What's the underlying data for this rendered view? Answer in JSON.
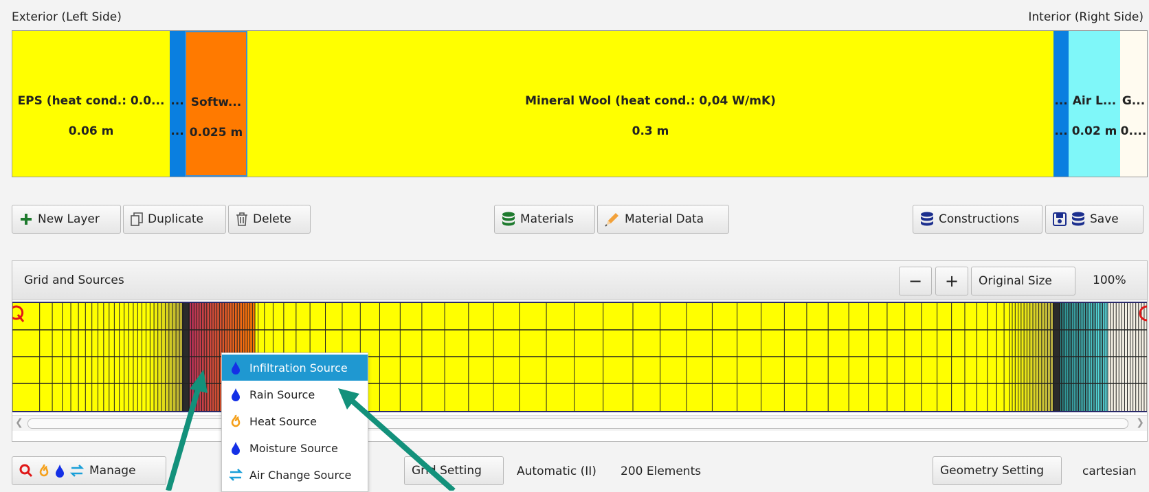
{
  "labels": {
    "exterior": "Exterior (Left Side)",
    "interior": "Interior (Right Side)"
  },
  "layers": [
    {
      "name": "EPS (heat cond.: 0.0...",
      "thickness": "0.06 m",
      "color": "#ffff00"
    },
    {
      "name": "...",
      "thickness": "...",
      "color": "#0a7fe0"
    },
    {
      "name": "Softw...",
      "thickness": "0.025 m",
      "color": "#ff7a00"
    },
    {
      "name": "Mineral Wool (heat cond.: 0,04 W/mK)",
      "thickness": "0.3 m",
      "color": "#ffff00"
    },
    {
      "name": "...",
      "thickness": "...",
      "color": "#0a7fe0"
    },
    {
      "name": "Air L...",
      "thickness": "0.02 m",
      "color": "#7ff7f9"
    },
    {
      "name": "G...",
      "thickness": "0....",
      "color": "#fffbf0"
    }
  ],
  "toolbar": {
    "new_layer": "New Layer",
    "duplicate": "Duplicate",
    "delete": "Delete",
    "materials": "Materials",
    "material_data": "Material Data",
    "constructions": "Constructions",
    "save": "Save"
  },
  "grid_panel": {
    "title": "Grid and Sources",
    "zoom_out": "−",
    "zoom_in": "+",
    "original_size": "Original Size",
    "zoom_level": "100%"
  },
  "context_menu": [
    {
      "label": "Infiltration Source",
      "icon": "water-drop-icon",
      "selected": true
    },
    {
      "label": "Rain Source",
      "icon": "water-drop-icon",
      "selected": false
    },
    {
      "label": "Heat Source",
      "icon": "flame-icon",
      "selected": false
    },
    {
      "label": "Moisture Source",
      "icon": "water-drop-icon",
      "selected": false
    },
    {
      "label": "Air Change Source",
      "icon": "exchange-icon",
      "selected": false
    }
  ],
  "bottom": {
    "manage": "Manage",
    "grid_setting": "Grid Setting",
    "grid_mode": "Automatic (II)",
    "elements": "200 Elements",
    "geometry_setting": "Geometry Setting",
    "geometry": "cartesian"
  },
  "colors": {
    "arrow": "#13917b",
    "menu_highlight": "#1f98d1",
    "accent_green": "#1e7a2e"
  }
}
